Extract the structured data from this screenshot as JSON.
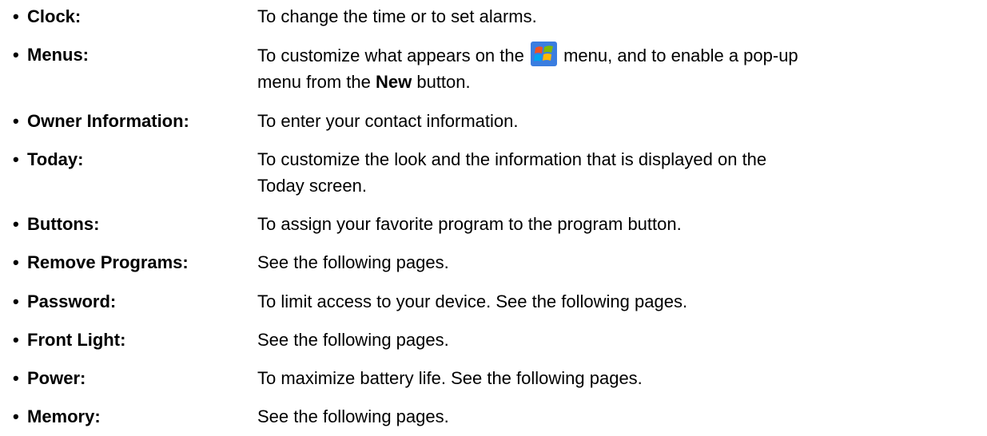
{
  "bullet": "•",
  "items": [
    {
      "term": "Clock:",
      "desc": "To change the time or to set alarms."
    },
    {
      "term": "Menus:",
      "desc_part1": "To customize what appears on the",
      "desc_part2": "menu, and to enable a pop-up",
      "desc_part3": "menu from the",
      "desc_bold": "New",
      "desc_part4": "button.",
      "icon": "windows-start-icon"
    },
    {
      "term": "Owner Information:",
      "desc": "To enter your contact information."
    },
    {
      "term": "Today:",
      "desc_line1": "To customize the look and the information that is displayed on the",
      "desc_line2": "Today screen."
    },
    {
      "term": "Buttons:",
      "desc": "To assign your favorite program to the program button."
    },
    {
      "term": "Remove Programs:",
      "desc": "See the following pages."
    },
    {
      "term": "Password:",
      "desc": "To limit access to your device. See the following pages."
    },
    {
      "term": "Front Light:",
      "desc": "See the following pages."
    },
    {
      "term": "Power:",
      "desc": "To maximize battery life. See the following pages."
    },
    {
      "term": "Memory:",
      "desc": "See the following pages."
    }
  ],
  "colors": {
    "text": "#000000",
    "background": "#ffffff",
    "logo_orange": "#f25022",
    "logo_green": "#7fba00",
    "logo_blue": "#00a4ef",
    "logo_yellow": "#ffb900",
    "logo_bg": "#3a7de0"
  }
}
